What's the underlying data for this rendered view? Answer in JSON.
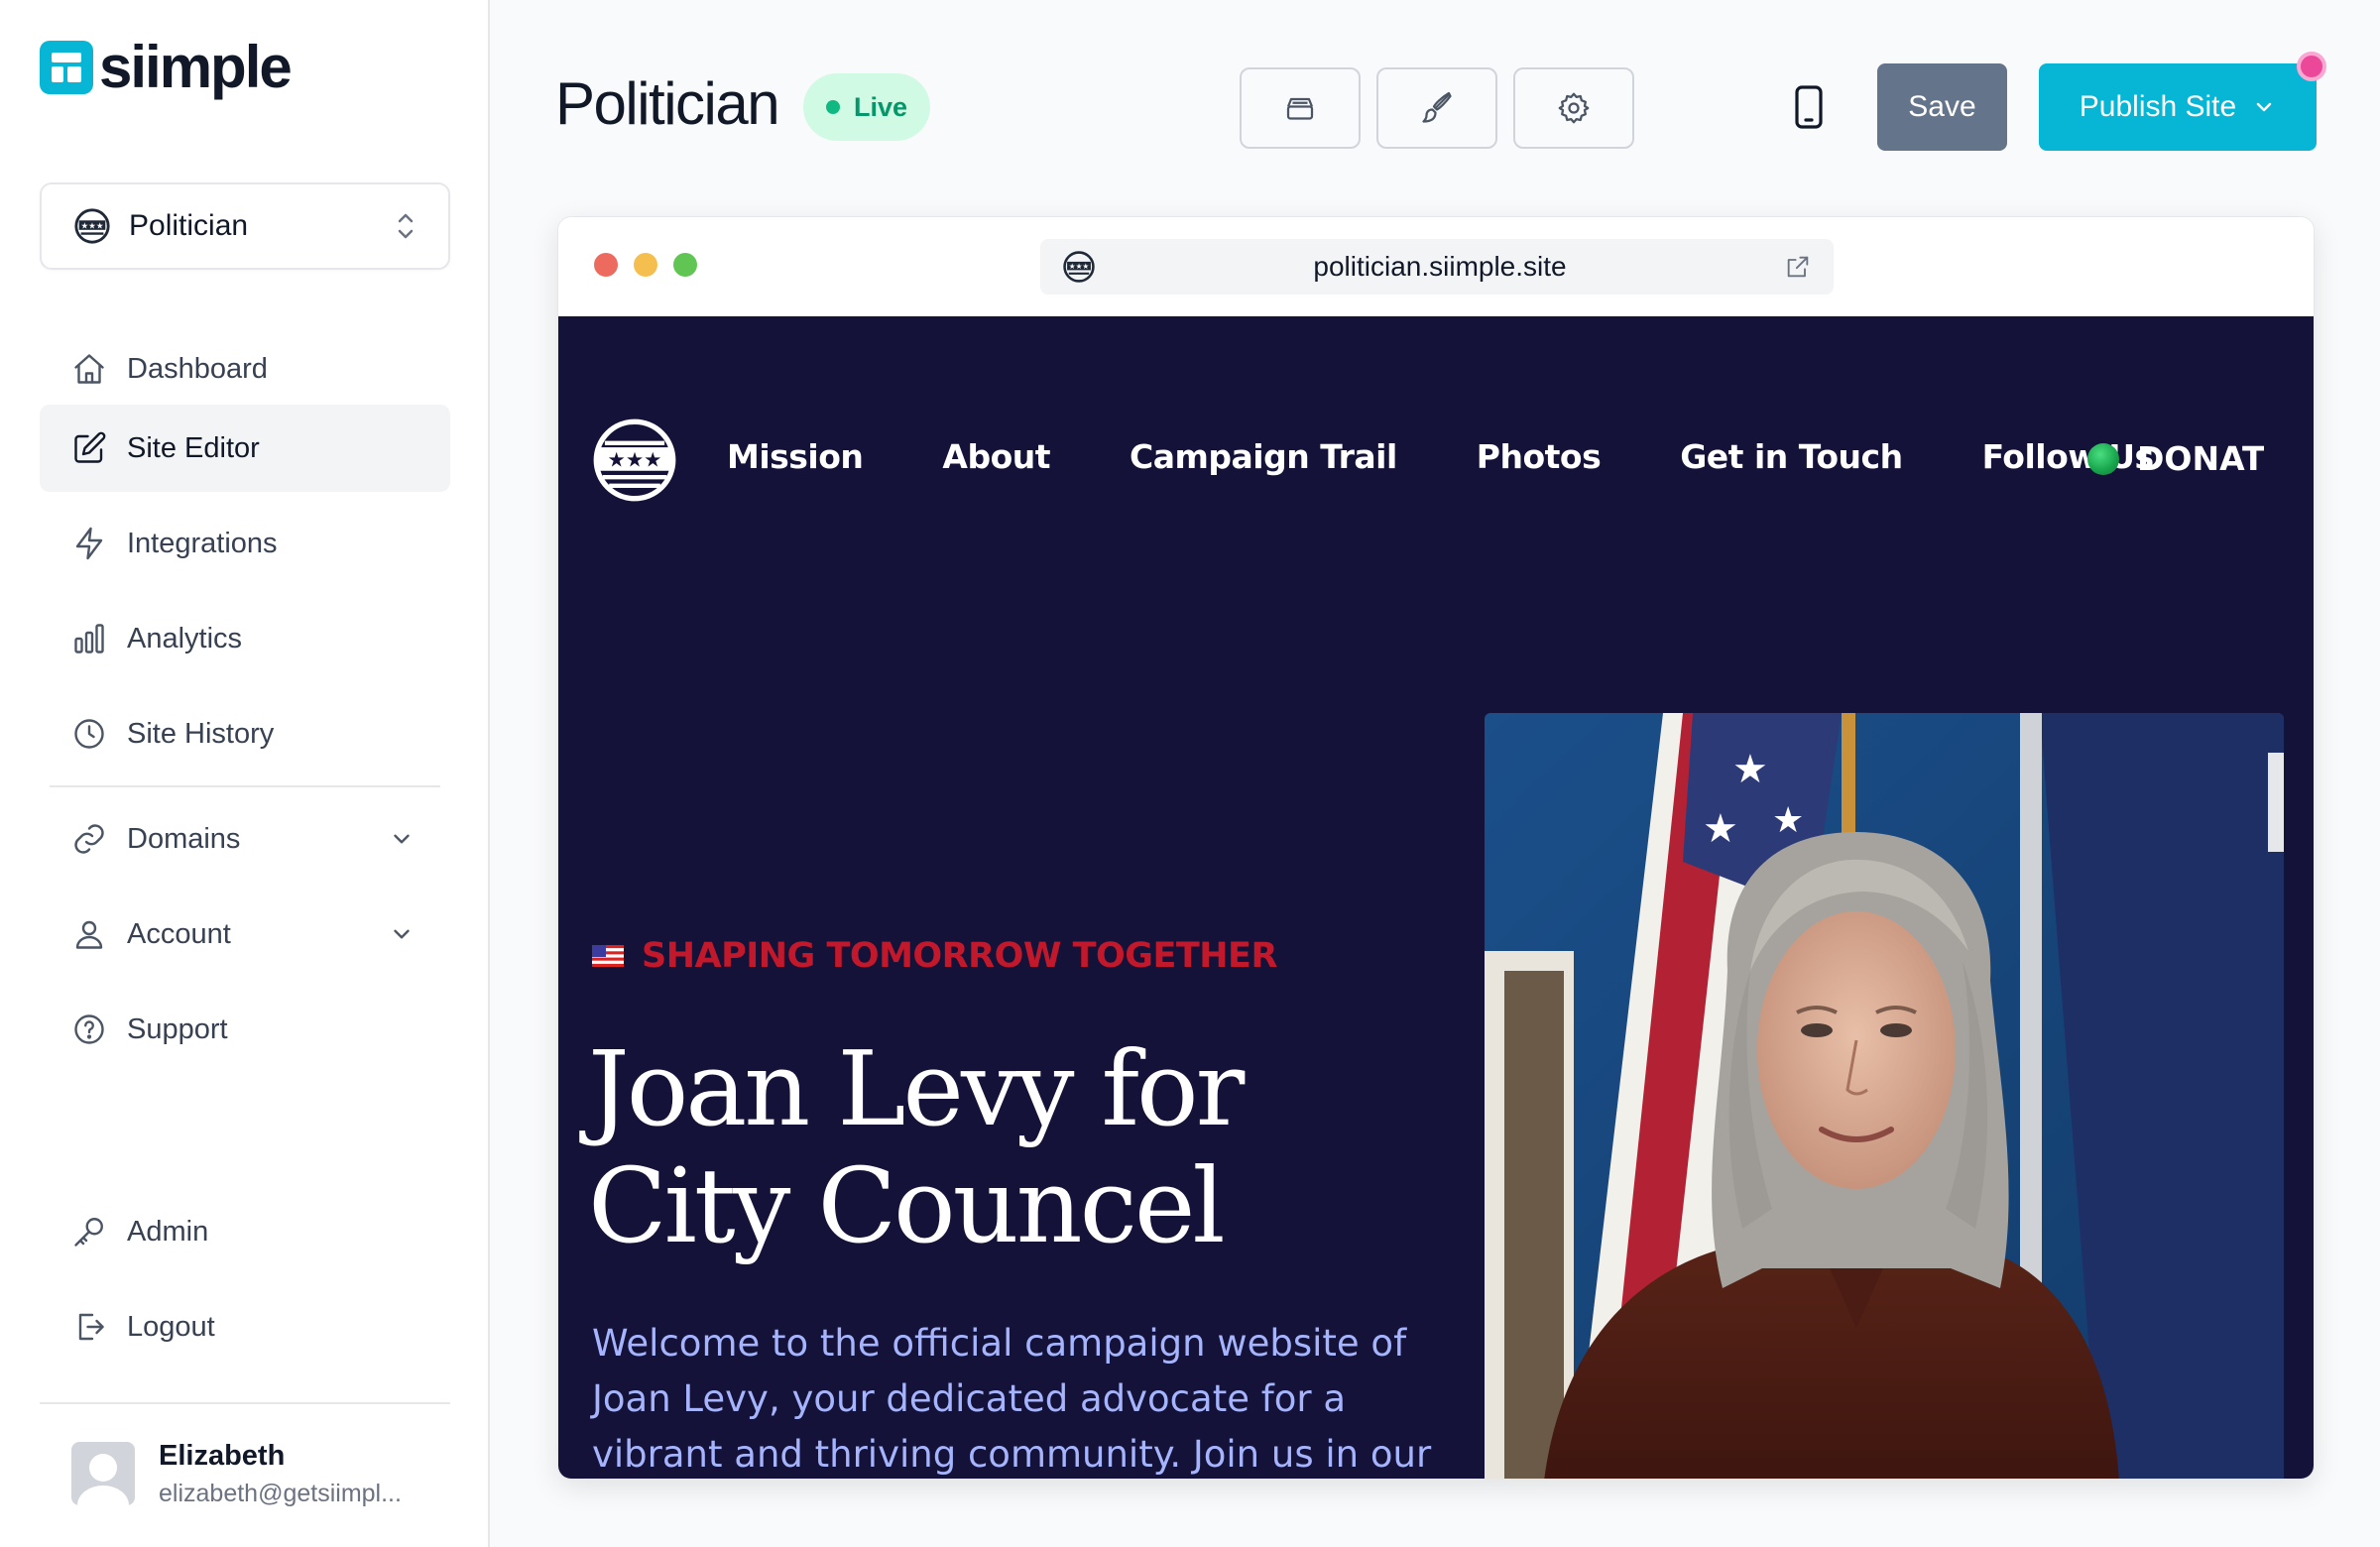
{
  "brand": {
    "name": "siimple"
  },
  "sidebar": {
    "site_selector": {
      "label": "Politician"
    },
    "nav": [
      {
        "label": "Dashboard",
        "icon": "home-icon"
      },
      {
        "label": "Site Editor",
        "icon": "edit-icon",
        "active": true
      },
      {
        "label": "Integrations",
        "icon": "lightning-icon"
      },
      {
        "label": "Analytics",
        "icon": "chart-bars-icon"
      },
      {
        "label": "Site History",
        "icon": "clock-icon"
      },
      {
        "label": "Domains",
        "icon": "link-icon",
        "expandable": true
      },
      {
        "label": "Account",
        "icon": "user-icon",
        "expandable": true
      },
      {
        "label": "Support",
        "icon": "help-circle-icon"
      },
      {
        "label": "Admin",
        "icon": "key-icon"
      },
      {
        "label": "Logout",
        "icon": "logout-icon"
      }
    ],
    "user": {
      "name": "Elizabeth",
      "email": "elizabeth@getsiimpl..."
    }
  },
  "header": {
    "title": "Politician",
    "status": "Live",
    "save_label": "Save",
    "publish_label": "Publish Site"
  },
  "browser": {
    "url": "politician.siimple.site",
    "traffic_lights": {
      "close": "#ed6a5e",
      "minimize": "#f5bf4f",
      "maximize": "#61c554"
    }
  },
  "site": {
    "nav_links": [
      "Mission",
      "About",
      "Campaign Trail",
      "Photos",
      "Get in Touch",
      "Follow Us"
    ],
    "donate_label": "DONATE N",
    "tagline": "SHAPING TOMORROW TOGETHER",
    "headline_line1": "Joan Levy for",
    "headline_line2": "City Councel",
    "intro": "Welcome to the official campaign website of Joan Levy, your dedicated advocate for a vibrant and thriving community. Join us in our journey"
  },
  "colors": {
    "accent": "#06b6d4",
    "save_button": "#64748b",
    "live_badge_bg": "#d1fae5",
    "live_badge_text": "#059669",
    "site_bg": "#141238",
    "tagline": "#c2182b",
    "intro_text": "#a5b4fc"
  }
}
